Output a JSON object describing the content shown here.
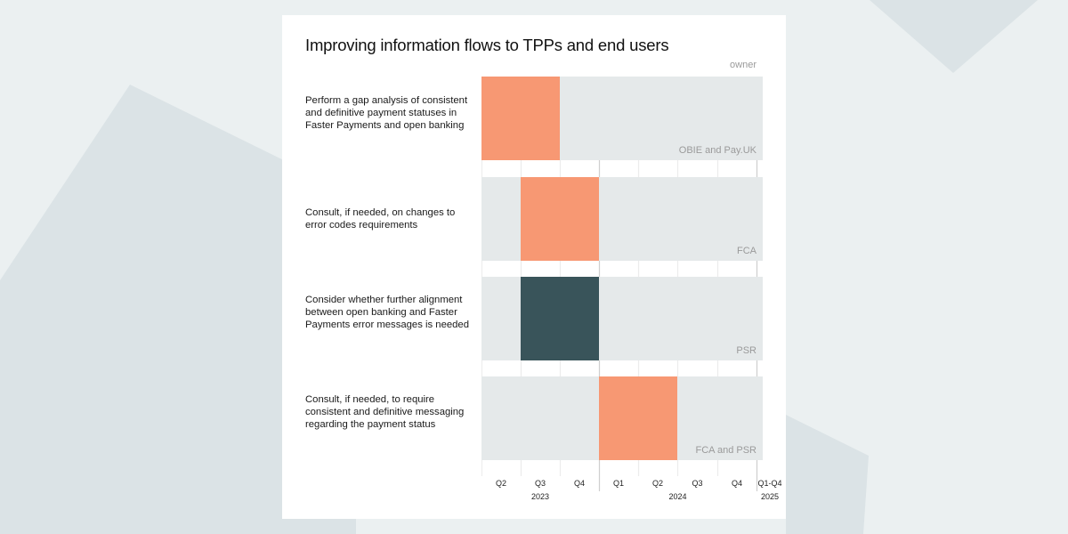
{
  "colors": {
    "page_bg": "#ebf0f1",
    "bg_shape": "#dbe3e6",
    "track": "#e5e9ea",
    "orange": "#f79873",
    "dark": "#39545a",
    "grid": "#ececec",
    "year_divider": "#cfcfcf"
  },
  "chart_data": {
    "type": "gantt",
    "title": "Improving information flows to TPPs and end users",
    "owner_header": "owner",
    "periods": [
      {
        "quarter": "Q2",
        "year": "2023"
      },
      {
        "quarter": "Q3",
        "year": "2023"
      },
      {
        "quarter": "Q4",
        "year": "2023"
      },
      {
        "quarter": "Q1",
        "year": "2024"
      },
      {
        "quarter": "Q2",
        "year": "2024"
      },
      {
        "quarter": "Q3",
        "year": "2024"
      },
      {
        "quarter": "Q4",
        "year": "2024"
      },
      {
        "quarter": "Q1-Q4",
        "year": "2025"
      }
    ],
    "years": [
      {
        "label": "2023",
        "start": 0,
        "end": 3
      },
      {
        "label": "2024",
        "start": 3,
        "end": 7
      },
      {
        "label": "2025",
        "start": 7,
        "end": 8
      }
    ],
    "tasks": [
      {
        "label": "Perform a gap analysis of consistent and definitive payment statuses in Faster Payments and open banking",
        "start": "Q2 2023",
        "end": "Q3 2023",
        "start_index": 0,
        "end_index": 2,
        "owner": "OBIE and Pay.UK",
        "color_key": "orange"
      },
      {
        "label": "Consult, if needed, on changes to error codes requirements",
        "start": "Q3 2023",
        "end": "Q4 2023",
        "start_index": 1,
        "end_index": 3,
        "owner": "FCA",
        "color_key": "orange"
      },
      {
        "label": "Consider whether further alignment between open banking and Faster Payments error messages is needed",
        "start": "Q3 2023",
        "end": "Q4 2023",
        "start_index": 1,
        "end_index": 3,
        "owner": "PSR",
        "color_key": "dark"
      },
      {
        "label": "Consult, if needed, to require consistent and definitive messaging regarding the payment status",
        "start": "Q1 2024",
        "end": "Q2 2024",
        "start_index": 3,
        "end_index": 5,
        "owner": "FCA and PSR",
        "color_key": "orange"
      }
    ]
  }
}
